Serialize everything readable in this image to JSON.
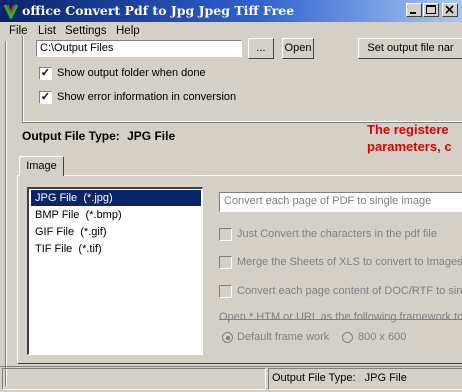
{
  "window": {
    "title": "office Convert Pdf to Jpg Jpeg Tiff Free"
  },
  "menu": [
    "File",
    "List",
    "Settings",
    "Help"
  ],
  "output": {
    "folder_value": "C:\\Output Files",
    "browse_label": "...",
    "open_label": "Open",
    "set_output_label": "Set output file nar",
    "show_folder_label": "Show output folder when done",
    "show_folder_checked": true,
    "show_errors_label": "Show error information in conversion",
    "show_errors_checked": true
  },
  "file_type": {
    "label": "Output File Type:",
    "value": "JPG File"
  },
  "notice": {
    "line1": "The registere",
    "line2": "parameters, c"
  },
  "tab": {
    "label": "Image"
  },
  "formats": [
    {
      "name": "JPG File",
      "ext": "(*.jpg)",
      "selected": true
    },
    {
      "name": "BMP File",
      "ext": "(*.bmp)",
      "selected": false
    },
    {
      "name": "GIF File",
      "ext": "(*.gif)",
      "selected": false
    },
    {
      "name": "TIF File",
      "ext": "(*.tif)",
      "selected": false
    }
  ],
  "options": {
    "convert_mode_value": "Convert each page of PDF to single image",
    "just_convert_label": "Just Convert the characters in the pdf file",
    "merge_sheets_label": "Merge the Sheets of XLS to convert to Images",
    "convert_doc_label": "Convert each page content of DOC/RTF to sin",
    "framework_label": "Open *.HTM or URL as the following framework to",
    "default_frame_label": "Default frame work",
    "size_label": "800 x 600"
  },
  "statusbar": {
    "label": "Output File Type:",
    "value": "JPG File"
  },
  "colors": {
    "title_blue": "#0a246a",
    "face": "#d4d0c8",
    "notice_red": "#e00000",
    "selection": "#0a246a"
  }
}
